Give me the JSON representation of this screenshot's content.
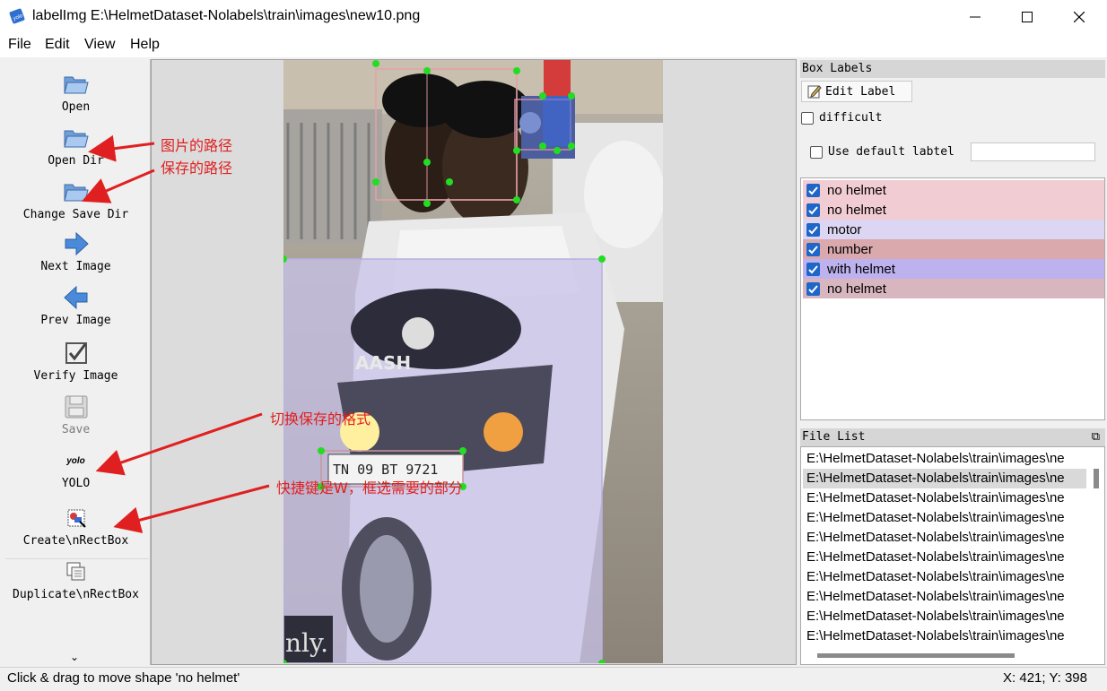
{
  "window": {
    "title": "labelImg E:\\HelmetDataset-Nolabels\\train\\images\\new10.png",
    "app_icon_text": "yolo"
  },
  "menu": [
    {
      "label": "File"
    },
    {
      "label": "Edit"
    },
    {
      "label": "View"
    },
    {
      "label": "Help"
    }
  ],
  "toolbar": {
    "open": "Open",
    "open_dir": "Open Dir",
    "change_save_dir": "Change Save Dir",
    "next_image": "Next Image",
    "prev_image": "Prev Image",
    "verify_image": "Verify Image",
    "save": "Save",
    "format_icon_text": "yolo",
    "format": "YOLO",
    "create_rect": "Create\\nRectBox",
    "duplicate_rect": "Duplicate\\nRectBox",
    "more": "⌄"
  },
  "annotations": {
    "image_path": "图片的路径",
    "save_path": "保存的路径",
    "switch_format": "切换保存的格式",
    "shortcut": "快捷键是W，框选需要的部分"
  },
  "box_labels": {
    "title": "Box Labels",
    "edit_label": "Edit Label",
    "difficult": "difficult",
    "use_default": "Use default labtel",
    "default_value": "",
    "items": [
      {
        "text": "no helmet",
        "bg": "#f2ccd3",
        "checked": true
      },
      {
        "text": "no helmet",
        "bg": "#f2ccd3",
        "checked": true
      },
      {
        "text": "motor",
        "bg": "#dcd6f2",
        "checked": true
      },
      {
        "text": "number",
        "bg": "#d9a9ae",
        "checked": true
      },
      {
        "text": "with helmet",
        "bg": "#bdb2ee",
        "checked": true
      },
      {
        "text": "no helmet",
        "bg": "#d8b6bf",
        "checked": true
      }
    ]
  },
  "file_list": {
    "title": "File List",
    "items": [
      "E:\\HelmetDataset-Nolabels\\train\\images\\ne",
      "E:\\HelmetDataset-Nolabels\\train\\images\\ne",
      "E:\\HelmetDataset-Nolabels\\train\\images\\ne",
      "E:\\HelmetDataset-Nolabels\\train\\images\\ne",
      "E:\\HelmetDataset-Nolabels\\train\\images\\ne",
      "E:\\HelmetDataset-Nolabels\\train\\images\\ne",
      "E:\\HelmetDataset-Nolabels\\train\\images\\ne",
      "E:\\HelmetDataset-Nolabels\\train\\images\\ne",
      "E:\\HelmetDataset-Nolabels\\train\\images\\ne",
      "E:\\HelmetDataset-Nolabels\\train\\images\\ne"
    ],
    "selected_index": 1
  },
  "photo_text": {
    "brand": "AASH",
    "plate": "TN 09   BT  9721",
    "watermark": "nly."
  },
  "status": {
    "message": "Click & drag to move shape 'no helmet'",
    "coords": "X: 421; Y: 398"
  },
  "colors": {
    "accent": "#1e66c8",
    "annotation": "#e02020",
    "handle": "#22dd22"
  }
}
